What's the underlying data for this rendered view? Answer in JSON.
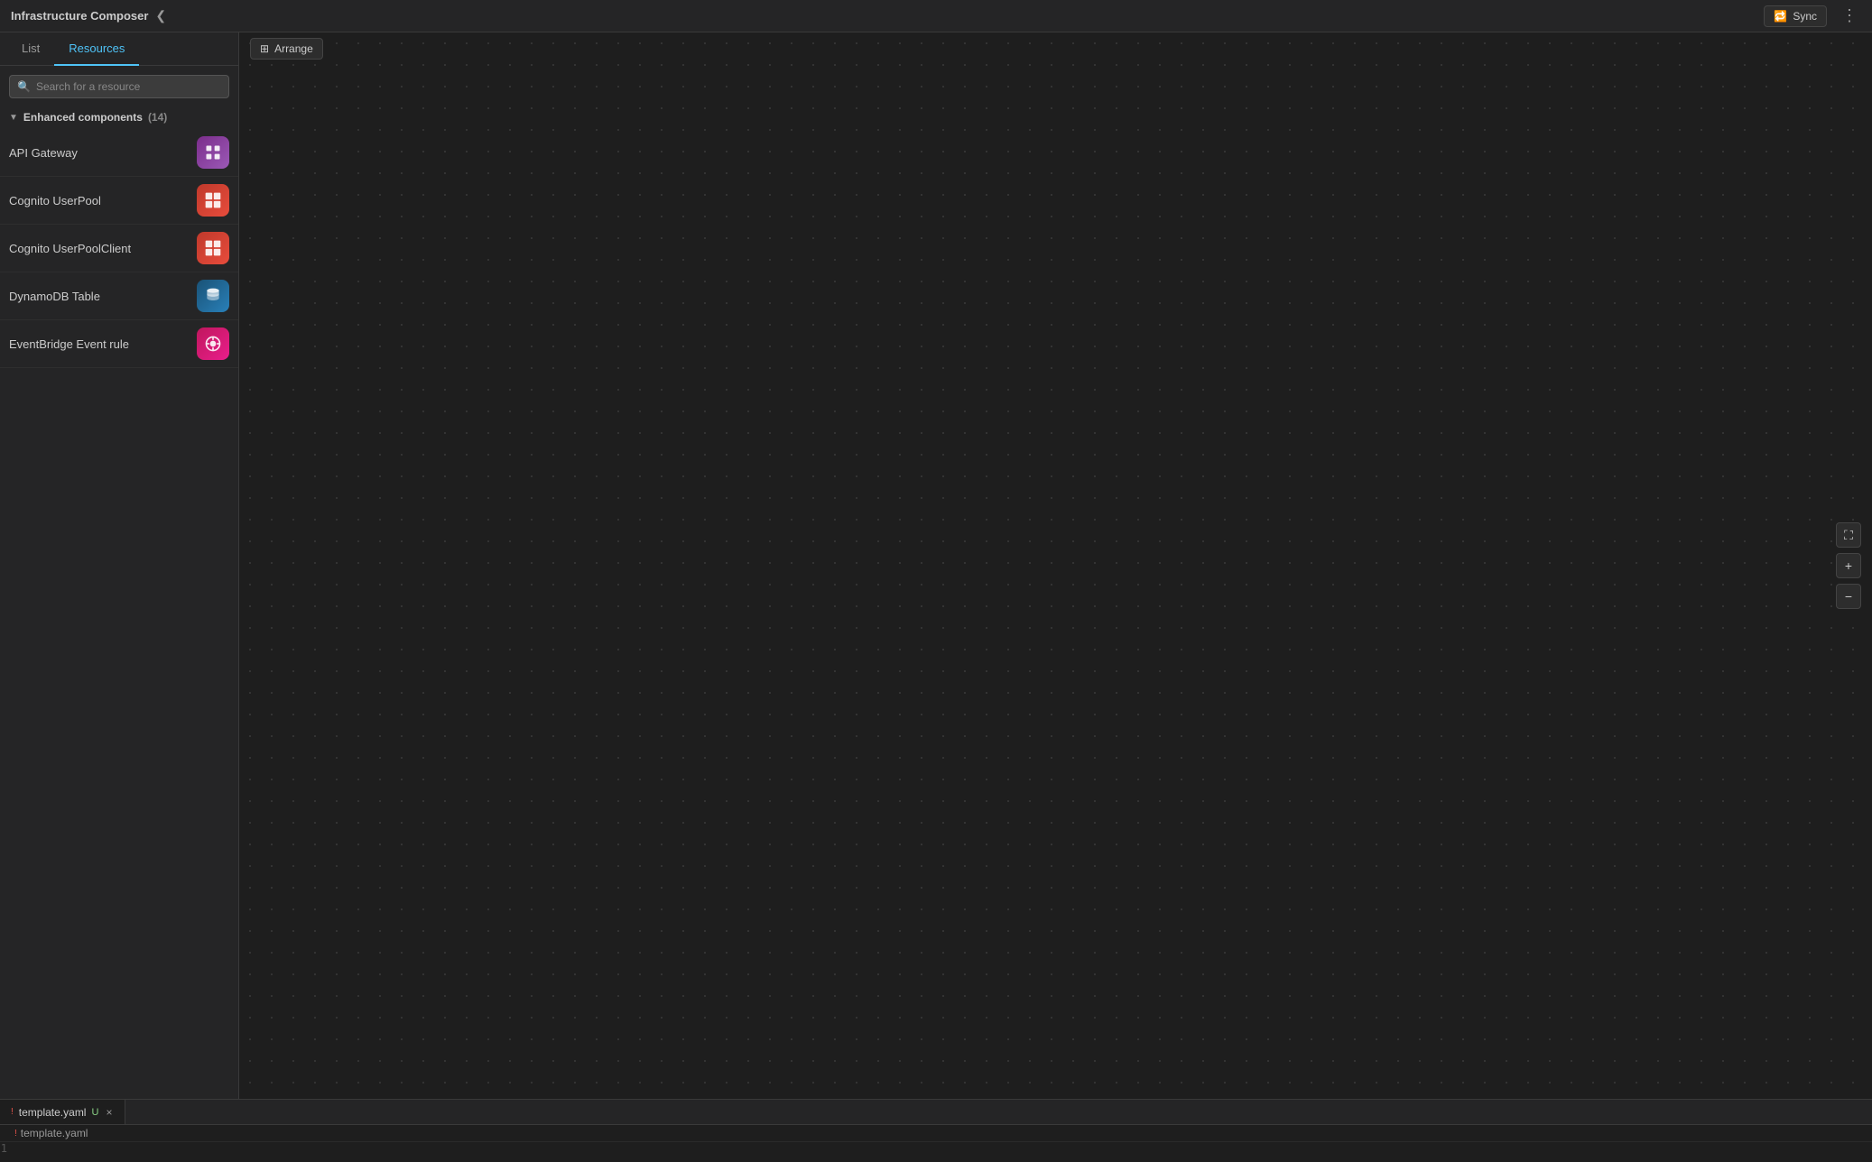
{
  "app": {
    "title": "Infrastructure Composer",
    "collapse_icon": "❮"
  },
  "header": {
    "arrange_label": "Arrange",
    "sync_label": "Sync",
    "sync_icon": "📡",
    "more_icon": "⋮"
  },
  "sidebar": {
    "tabs": [
      {
        "id": "list",
        "label": "List",
        "active": false
      },
      {
        "id": "resources",
        "label": "Resources",
        "active": true
      }
    ],
    "search": {
      "placeholder": "Search for a resource"
    },
    "sections": [
      {
        "id": "enhanced",
        "label": "Enhanced components",
        "count": "(14)",
        "expanded": true,
        "items": [
          {
            "id": "api-gateway",
            "name": "API Gateway",
            "icon_bg": "#7b2d8b",
            "icon_color": "#fff",
            "icon": "⊞"
          },
          {
            "id": "cognito-userpool",
            "name": "Cognito UserPool",
            "icon_bg": "#c0392b",
            "icon_color": "#fff",
            "icon": "⊟"
          },
          {
            "id": "cognito-userpoolclient",
            "name": "Cognito UserPoolClient",
            "icon_bg": "#c0392b",
            "icon_color": "#fff",
            "icon": "⊟"
          },
          {
            "id": "dynamodb-table",
            "name": "DynamoDB Table",
            "icon_bg": "#2471a3",
            "icon_color": "#fff",
            "icon": "⊠"
          },
          {
            "id": "eventbridge-event-rule",
            "name": "EventBridge Event rule",
            "icon_bg": "#e91e8c",
            "icon_color": "#fff",
            "icon": "⊕"
          }
        ]
      }
    ]
  },
  "editor": {
    "tab_filename": "template.yaml",
    "tab_modified": "U",
    "breadcrumb_filename": "template.yaml",
    "line_number": "1"
  },
  "canvas_controls": {
    "expand_icon": "⛶",
    "zoom_in_icon": "+",
    "zoom_out_icon": "−"
  }
}
